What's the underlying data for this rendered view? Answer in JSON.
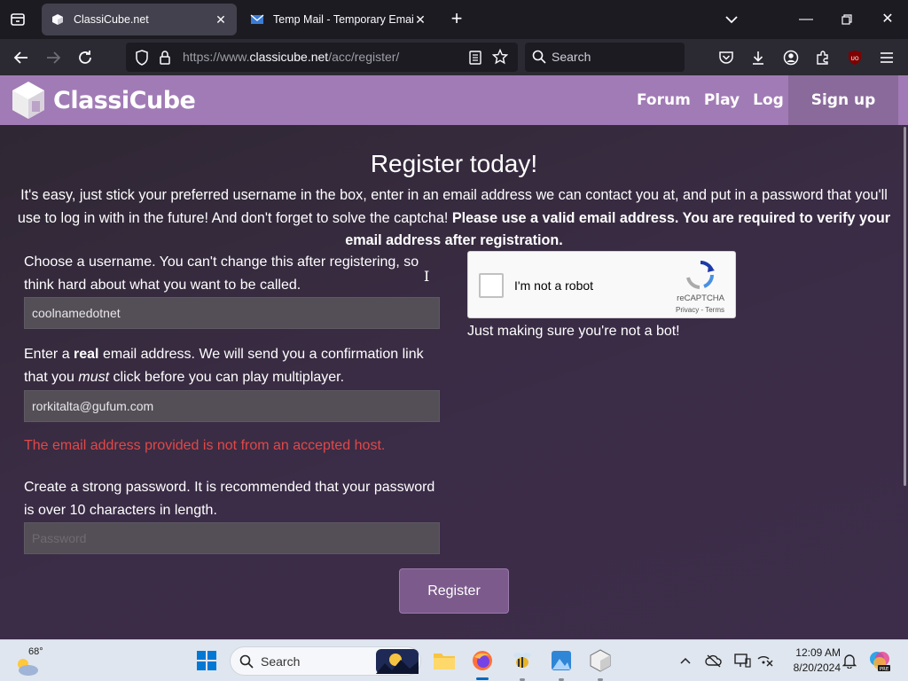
{
  "browser": {
    "tabs": [
      {
        "title": "ClassiCube.net",
        "active": true
      },
      {
        "title": "Temp Mail - Temporary Email",
        "active": false
      }
    ],
    "url_prefix": "https://www.",
    "url_domain": "classicube.net",
    "url_path": "/acc/register/",
    "search_placeholder": "Search"
  },
  "site": {
    "logo_text": "ClassiCube",
    "nav": [
      "Forum",
      "Play",
      "Log in"
    ],
    "signup_label": "Sign up"
  },
  "form": {
    "heading": "Register today!",
    "intro_plain": "It's easy, just stick your preferred username in the box, enter in an email address we can contact you at, and put in a password that you'll use to log in with in the future! And don't forget to solve the captcha! ",
    "intro_bold": "Please use a valid email address. You are required to verify your email address after registration.",
    "username_label": "Choose a username. You can't change this after registering, so think hard about what you want to be called.",
    "username_value": "coolnamedotnet",
    "email_label_1": "Enter a ",
    "email_label_bold": "real",
    "email_label_2": " email address. We will send you a confirmation link that you ",
    "email_label_italic": "must",
    "email_label_3": " click before you can play multiplayer.",
    "email_value": "rorkitalta@gufum.com",
    "error_text": "The email address provided is not from an accepted host.",
    "password_label": "Create a strong password. It is recommended that your password is over 10 characters in length.",
    "password_placeholder": "Password",
    "register_label": "Register",
    "captcha_text": "I'm not a robot",
    "captcha_brand": "reCAPTCHA",
    "captcha_terms": "Privacy - Terms",
    "bot_note": "Just making sure you're not a bot!"
  },
  "taskbar": {
    "weather_temp": "68°",
    "search_label": "Search",
    "time": "12:09 AM",
    "date": "8/20/2024"
  },
  "colors": {
    "header": "#a17bb5",
    "signup_bg": "#8a6a9b",
    "error": "#e04848",
    "register_btn": "#7c5a8c"
  }
}
